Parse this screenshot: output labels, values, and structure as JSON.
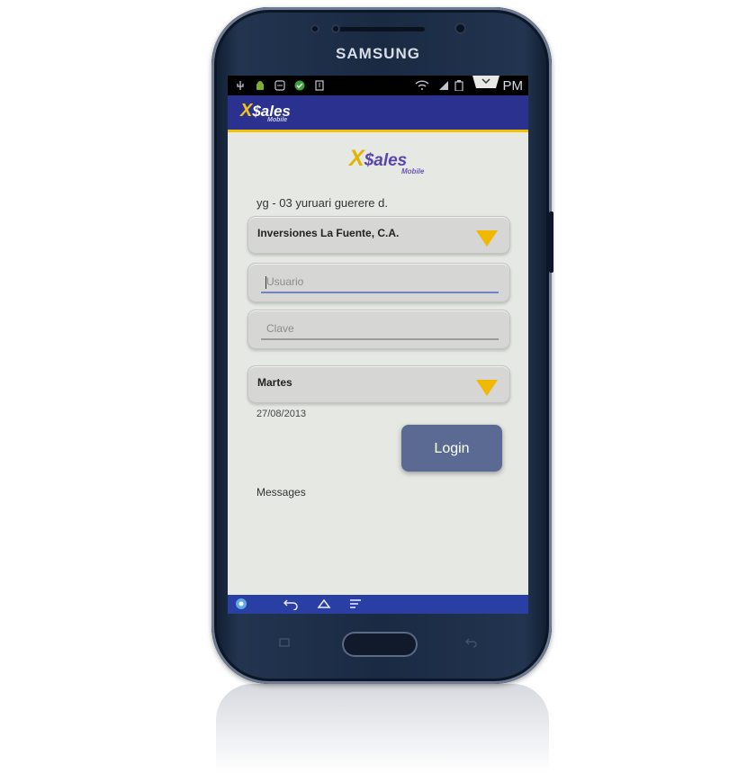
{
  "device": {
    "brand": "SAMSUNG"
  },
  "status_bar": {
    "time": "PM",
    "icons": [
      "usb-icon",
      "android-icon",
      "network-icon",
      "check-icon",
      "download-icon",
      "wifi-icon",
      "signal-icon",
      "battery-icon"
    ]
  },
  "app": {
    "logo_small": {
      "x": "X",
      "word": "$ales",
      "sub": "Mobile"
    },
    "logo_large": {
      "x": "X",
      "word": "$ales",
      "sub": "Mobile"
    },
    "user_line": "yg - 03 yuruari guerere d.",
    "company_select": {
      "selected": "Inversiones La Fuente, C.A."
    },
    "username_field": {
      "placeholder": "Usuario",
      "value": ""
    },
    "password_field": {
      "placeholder": "Clave",
      "value": ""
    },
    "day_select": {
      "selected": "Martes"
    },
    "date": "27/08/2013",
    "login_label": "Login",
    "messages_label": "Messages"
  },
  "nav_bar": {
    "icons": [
      "app-icon",
      "back-icon",
      "home-icon",
      "menu-icon"
    ]
  },
  "colors": {
    "app_bar": "#2b318f",
    "accent": "#f1c200",
    "login_button": "#5a6a92",
    "nav_bar": "#2a3fa4"
  }
}
